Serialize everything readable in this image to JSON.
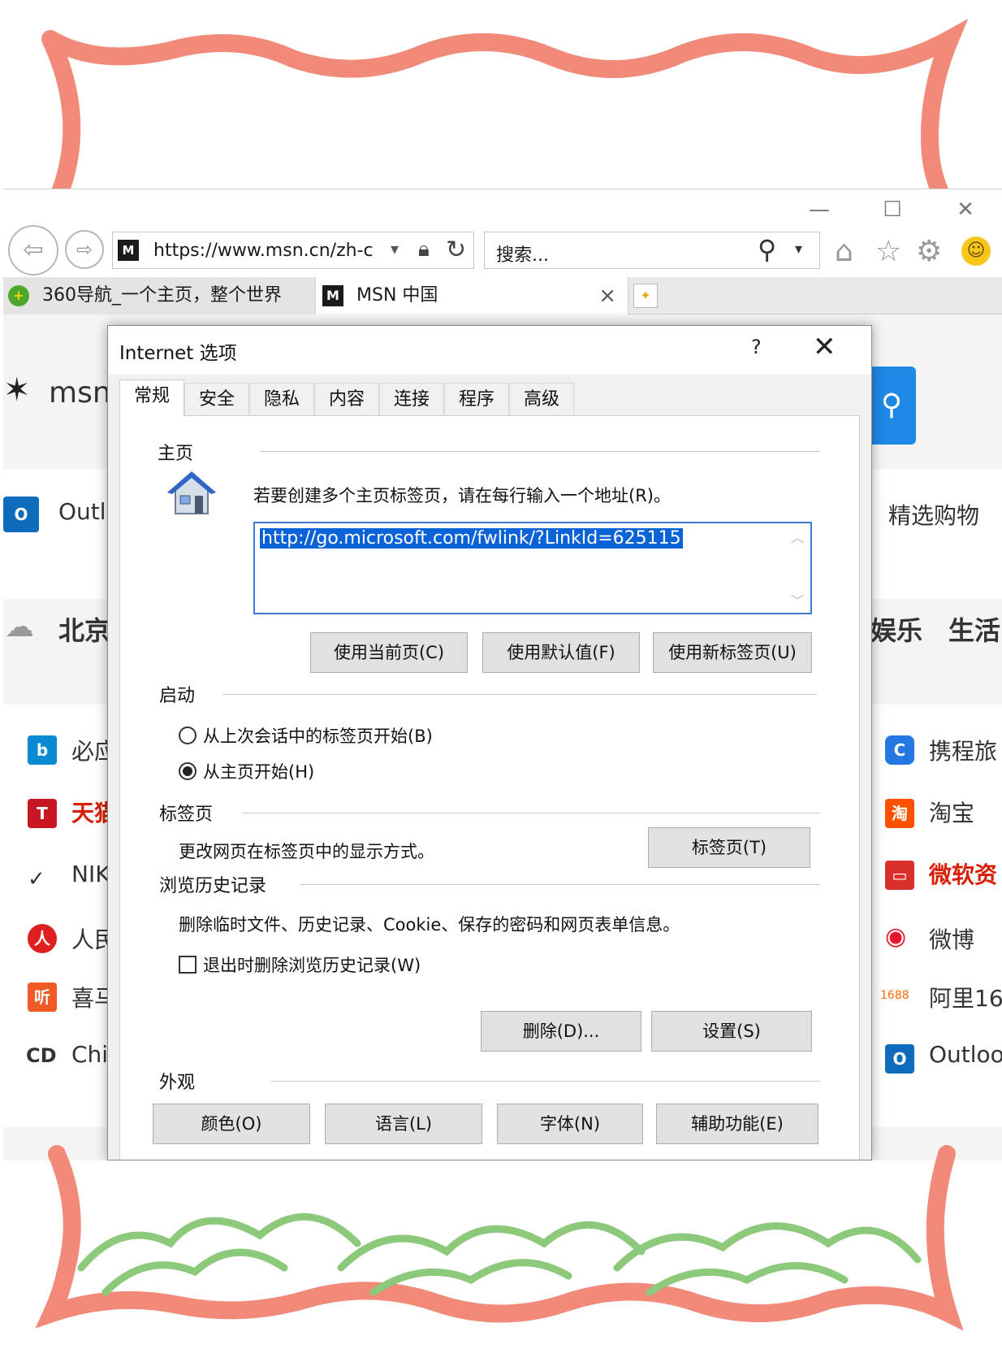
{
  "browser": {
    "window_controls": {
      "minimize": "—",
      "maximize": "☐",
      "close": "✕"
    },
    "address_url": "https://www.msn.cn/zh-c",
    "search_placeholder": "搜索...",
    "tabs": [
      {
        "label": "360导航_一个主页，整个世界"
      },
      {
        "label": "MSN 中国"
      }
    ]
  },
  "page_background": {
    "logo": "msn",
    "left_items": [
      "Outl",
      "北京",
      "必应",
      "天猫",
      "NIK",
      "人民",
      "喜马",
      "Chi"
    ],
    "right_items": [
      "精选购物",
      "娱乐",
      "生活",
      "携程旅",
      "淘宝",
      "微软资",
      "微博",
      "阿里16",
      "Outloo"
    ],
    "icon_1688": "1688",
    "icon_cd": "CD"
  },
  "dialog": {
    "title": "Internet 选项",
    "help": "?",
    "close": "✕",
    "tabs": [
      "常规",
      "安全",
      "隐私",
      "内容",
      "连接",
      "程序",
      "高级"
    ],
    "homepage": {
      "group": "主页",
      "instruction": "若要创建多个主页标签页，请在每行输入一个地址(R)。",
      "url": "http://go.microsoft.com/fwlink/?LinkId=625115",
      "buttons": [
        "使用当前页(C)",
        "使用默认值(F)",
        "使用新标签页(U)"
      ]
    },
    "startup": {
      "group": "启动",
      "options": [
        "从上次会话中的标签页开始(B)",
        "从主页开始(H)"
      ],
      "selected_index": 1
    },
    "tabs_group": {
      "group": "标签页",
      "description": "更改网页在标签页中的显示方式。",
      "button": "标签页(T)"
    },
    "history": {
      "group": "浏览历史记录",
      "description": "删除临时文件、历史记录、Cookie、保存的密码和网页表单信息。",
      "checkbox_label": "退出时删除浏览历史记录(W)",
      "checkbox_checked": false,
      "buttons": [
        "删除(D)...",
        "设置(S)"
      ]
    },
    "appearance": {
      "group": "外观",
      "buttons": [
        "颜色(O)",
        "语言(L)",
        "字体(N)",
        "辅助功能(E)"
      ]
    }
  }
}
